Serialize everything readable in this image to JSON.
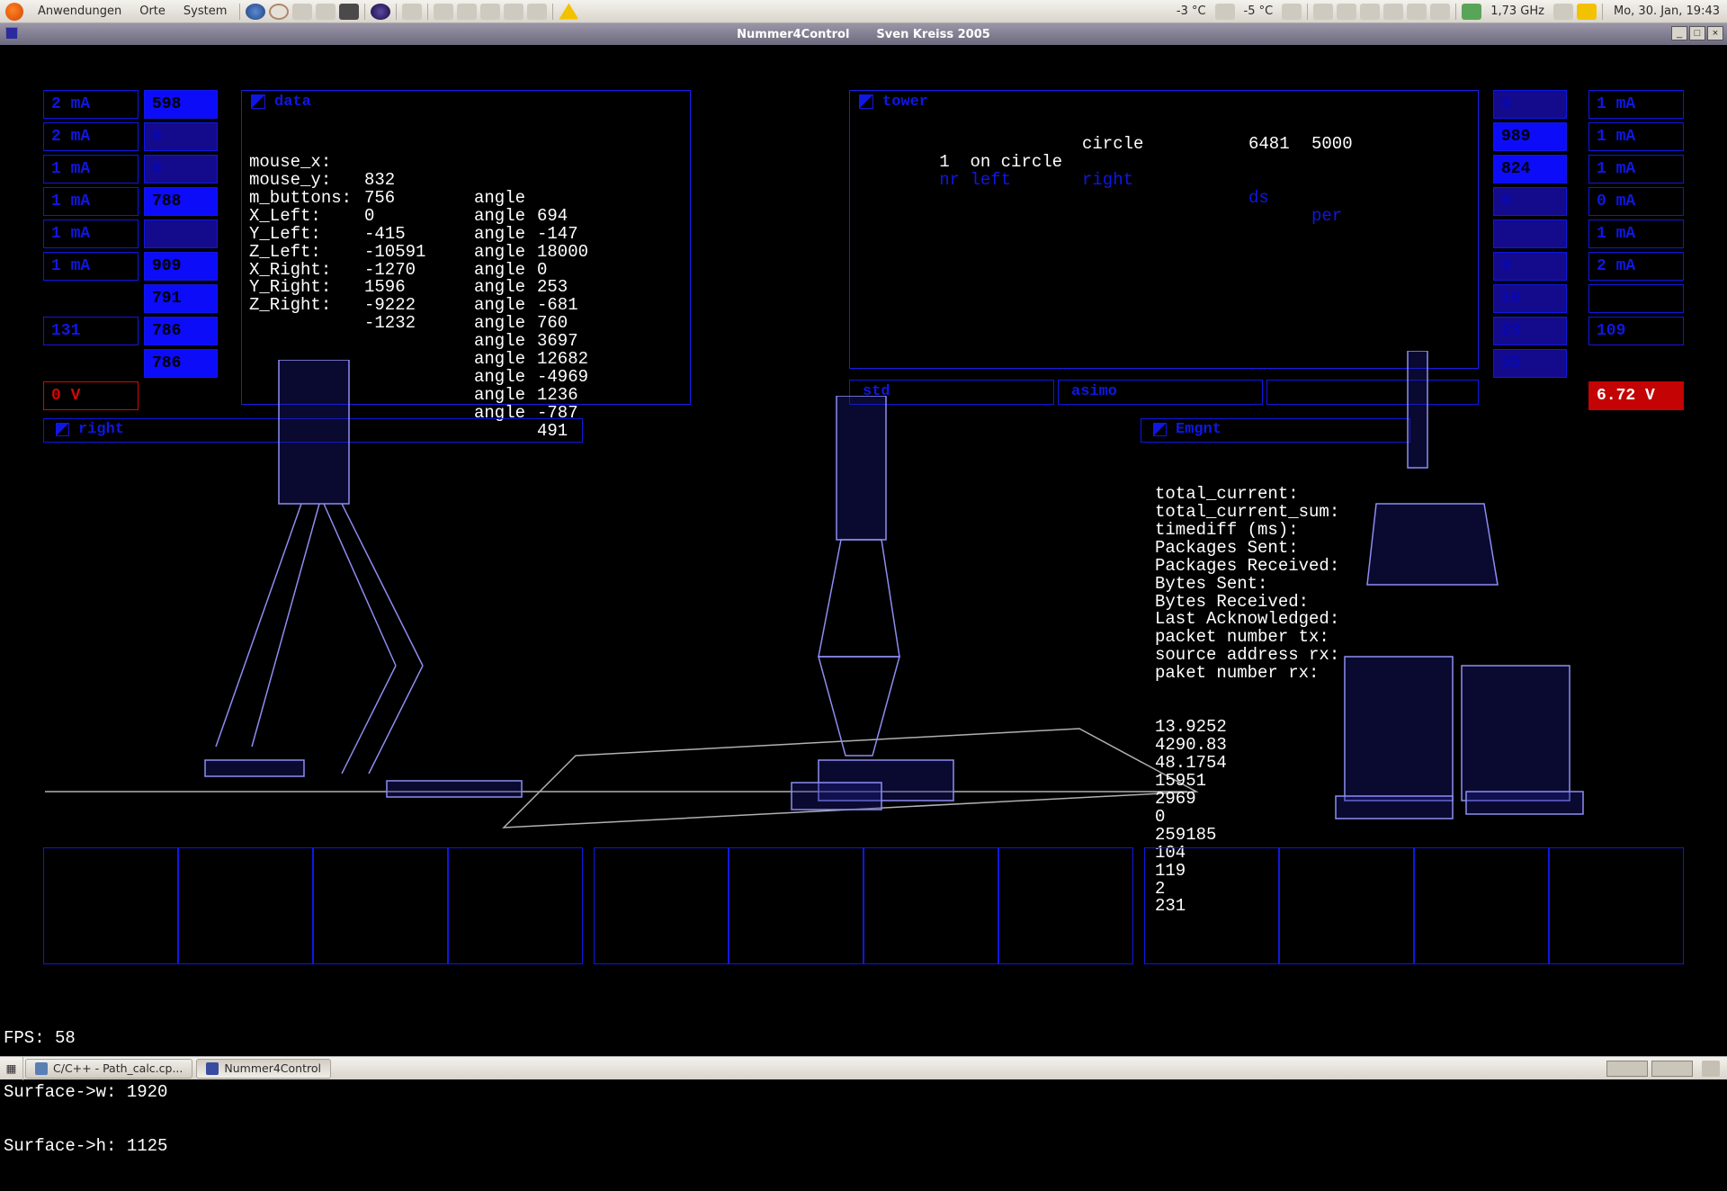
{
  "top_panel": {
    "menu": [
      "Anwendungen",
      "Orte",
      "System"
    ],
    "temp1": "-3 °C",
    "temp2": "-5 °C",
    "cpu": "1,73 GHz",
    "clock": "Mo, 30. Jan, 19:43"
  },
  "window": {
    "title_left": "Nummer4Control",
    "title_right": "Sven Kreiss 2005"
  },
  "left_cells_col1": [
    "2 mA",
    "2 mA",
    "1 mA",
    "1 mA",
    "1 mA",
    "1 mA"
  ],
  "left_cells_col2": [
    "598",
    "0",
    "0",
    "788",
    "",
    "909",
    "791",
    "786",
    "786"
  ],
  "left_extra": "131",
  "left_voltage": "0 V",
  "right_cells_col1": [
    "0",
    "989",
    "824",
    "0",
    "",
    "0",
    "16",
    "23",
    "35"
  ],
  "right_cells_col2": [
    "1 mA",
    "1 mA",
    "1 mA",
    "0 mA",
    "1 mA",
    "2 mA",
    "",
    "109"
  ],
  "right_voltage": "6.72 V",
  "data_panel": {
    "title": "data",
    "left_labels": [
      "mouse_x:",
      "mouse_y:",
      "m_buttons:",
      "X_Left:",
      "Y_Left:",
      "Z_Left:",
      "X_Right:",
      "Y_Right:",
      "Z_Right:"
    ],
    "left_values": [
      "832",
      "756",
      "0",
      "-415",
      "-10591",
      "-1270",
      "1596",
      "-9222",
      "-1232"
    ],
    "right_labels": [
      "angle",
      "angle",
      "angle",
      "angle",
      "angle",
      "angle",
      "angle",
      "angle",
      "angle",
      "angle",
      "angle",
      "angle",
      "angle"
    ],
    "right_values": [
      "694",
      "-147",
      "18000",
      "0",
      "253",
      "-681",
      "760",
      "3697",
      "12682",
      "-4969",
      "1236",
      "-787",
      "491"
    ]
  },
  "tower_panel": {
    "title": "tower",
    "head": [
      "nr",
      "left",
      "right",
      "ds",
      "per"
    ],
    "row": [
      "1",
      "on circle",
      "circle",
      "6481",
      "5000"
    ],
    "btn_std": "std",
    "btn_asimo": "asimo"
  },
  "right_vp_title": "right",
  "Emgnt_panel": {
    "title": "Emgnt",
    "labels": [
      "total_current:",
      "total_current_sum:",
      "timediff (ms):",
      "Packages Sent:",
      "Packages Received:",
      "Bytes Sent:",
      "Bytes Received:",
      "Last Acknowledged:",
      "packet number tx:",
      "source address rx:",
      "paket number rx:"
    ],
    "values": [
      "13.9252",
      "4290.83",
      "48.1754",
      "15951",
      "2969",
      "0",
      "259185",
      "104",
      "119",
      "2",
      "231"
    ]
  },
  "status": {
    "fps": "FPS: 58",
    "w": "Surface->w: 1920",
    "h": "Surface->h: 1125"
  },
  "taskbar": {
    "task1": "C/C++ - Path_calc.cp...",
    "task2": "Nummer4Control"
  }
}
